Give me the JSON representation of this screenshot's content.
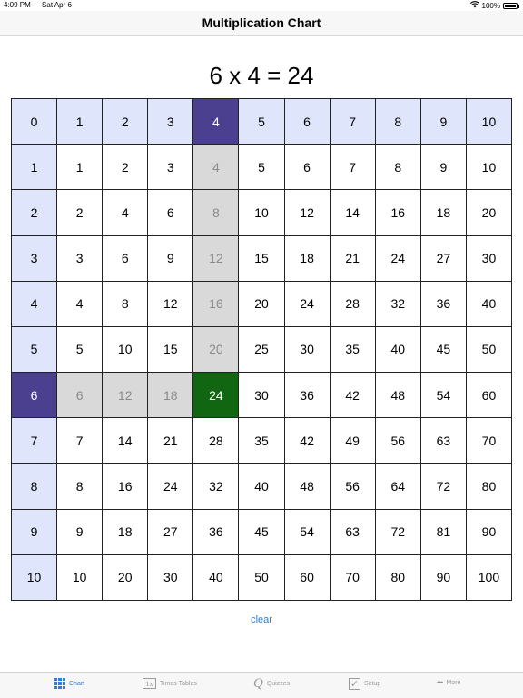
{
  "status": {
    "time": "4:09 PM",
    "date": "Sat Apr 6",
    "battery": "100%"
  },
  "nav": {
    "title": "Multiplication Chart"
  },
  "equation": "6 x 4 = 24",
  "chart": {
    "selected_row": 6,
    "selected_col": 4,
    "header_values": [
      "0",
      "1",
      "2",
      "3",
      "4",
      "5",
      "6",
      "7",
      "8",
      "9",
      "10"
    ],
    "rows": [
      [
        "0",
        "1",
        "2",
        "3",
        "4",
        "5",
        "6",
        "7",
        "8",
        "9",
        "10"
      ],
      [
        "1",
        "1",
        "2",
        "3",
        "4",
        "5",
        "6",
        "7",
        "8",
        "9",
        "10"
      ],
      [
        "2",
        "2",
        "4",
        "6",
        "8",
        "10",
        "12",
        "14",
        "16",
        "18",
        "20"
      ],
      [
        "3",
        "3",
        "6",
        "9",
        "12",
        "15",
        "18",
        "21",
        "24",
        "27",
        "30"
      ],
      [
        "4",
        "4",
        "8",
        "12",
        "16",
        "20",
        "24",
        "28",
        "32",
        "36",
        "40"
      ],
      [
        "5",
        "5",
        "10",
        "15",
        "20",
        "25",
        "30",
        "35",
        "40",
        "45",
        "50"
      ],
      [
        "6",
        "6",
        "12",
        "18",
        "24",
        "30",
        "36",
        "42",
        "48",
        "54",
        "60"
      ],
      [
        "7",
        "7",
        "14",
        "21",
        "28",
        "35",
        "42",
        "49",
        "56",
        "63",
        "70"
      ],
      [
        "8",
        "8",
        "16",
        "24",
        "32",
        "40",
        "48",
        "56",
        "64",
        "72",
        "80"
      ],
      [
        "9",
        "9",
        "18",
        "27",
        "36",
        "45",
        "54",
        "63",
        "72",
        "81",
        "90"
      ],
      [
        "10",
        "10",
        "20",
        "30",
        "40",
        "50",
        "60",
        "70",
        "80",
        "90",
        "100"
      ]
    ]
  },
  "clear_label": "clear",
  "tabs": [
    {
      "label": "Chart",
      "icon": "grid-icon",
      "active": true
    },
    {
      "label": "Times Tables",
      "icon": "times-tables-icon",
      "icon_text": "1x",
      "active": false
    },
    {
      "label": "Quizzes",
      "icon": "quiz-icon",
      "icon_text": "Q",
      "active": false
    },
    {
      "label": "Setup",
      "icon": "checkmark-icon",
      "icon_text": "✓",
      "active": false
    },
    {
      "label": "More",
      "icon": "more-dots-icon",
      "icon_text": "•••",
      "active": false
    }
  ],
  "colors": {
    "header_bg": "#dfe6fb",
    "selected_header_bg": "#4b3f8f",
    "path_bg": "#d9d9d9",
    "result_bg": "#116611",
    "accent": "#2e7ce0"
  }
}
